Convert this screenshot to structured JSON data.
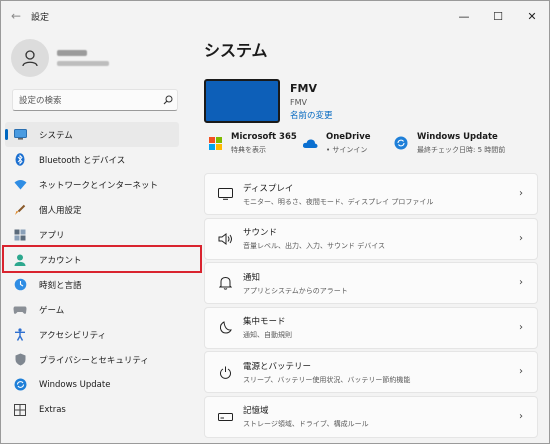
{
  "window": {
    "title": "設定",
    "back": "←",
    "minimize": "—",
    "maximize": "☐",
    "close": "✕"
  },
  "profile": {
    "name": "",
    "email": ""
  },
  "search": {
    "placeholder": "設定の検索"
  },
  "nav": [
    {
      "label": "システム",
      "icon": "monitor-icon",
      "selected": true
    },
    {
      "label": "Bluetooth とデバイス",
      "icon": "bluetooth-icon"
    },
    {
      "label": "ネットワークとインターネット",
      "icon": "wifi-icon"
    },
    {
      "label": "個人用設定",
      "icon": "brush-icon"
    },
    {
      "label": "アプリ",
      "icon": "apps-icon"
    },
    {
      "label": "アカウント",
      "icon": "person-icon",
      "highlighted": true
    },
    {
      "label": "時刻と言語",
      "icon": "clock-globe-icon"
    },
    {
      "label": "ゲーム",
      "icon": "gamepad-icon"
    },
    {
      "label": "アクセシビリティ",
      "icon": "accessibility-icon"
    },
    {
      "label": "プライバシーとセキュリティ",
      "icon": "shield-icon"
    },
    {
      "label": "Windows Update",
      "icon": "update-icon"
    },
    {
      "label": "Extras",
      "icon": "extras-icon"
    }
  ],
  "main": {
    "title": "システム",
    "device": {
      "name": "FMV",
      "model": "FMV",
      "rename": "名前の変更"
    },
    "quick": [
      {
        "title": "Microsoft 365",
        "sub": "特典を表示",
        "icon": "microsoft-icon"
      },
      {
        "title": "OneDrive",
        "sub": "• サインイン",
        "icon": "onedrive-icon"
      },
      {
        "title": "Windows Update",
        "sub": "最終チェック日時: 5 時間前",
        "icon": "windows-update-icon"
      }
    ],
    "cards": [
      {
        "title": "ディスプレイ",
        "desc": "モニター、明るさ、夜間モード、ディスプレイ プロファイル",
        "icon": "display-icon"
      },
      {
        "title": "サウンド",
        "desc": "音量レベル、出力、入力、サウンド デバイス",
        "icon": "speaker-icon"
      },
      {
        "title": "通知",
        "desc": "アプリとシステムからのアラート",
        "icon": "bell-icon"
      },
      {
        "title": "集中モード",
        "desc": "通知、自動規則",
        "icon": "moon-icon"
      },
      {
        "title": "電源とバッテリー",
        "desc": "スリープ、バッテリー使用状況、バッテリー節約機能",
        "icon": "power-icon"
      },
      {
        "title": "記憶域",
        "desc": "ストレージ領域、ドライブ、構成ルール",
        "icon": "storage-icon"
      }
    ]
  },
  "colors": {
    "accent": "#0067c0",
    "highlight": "#d9232e",
    "device": "#0d5fb8"
  }
}
